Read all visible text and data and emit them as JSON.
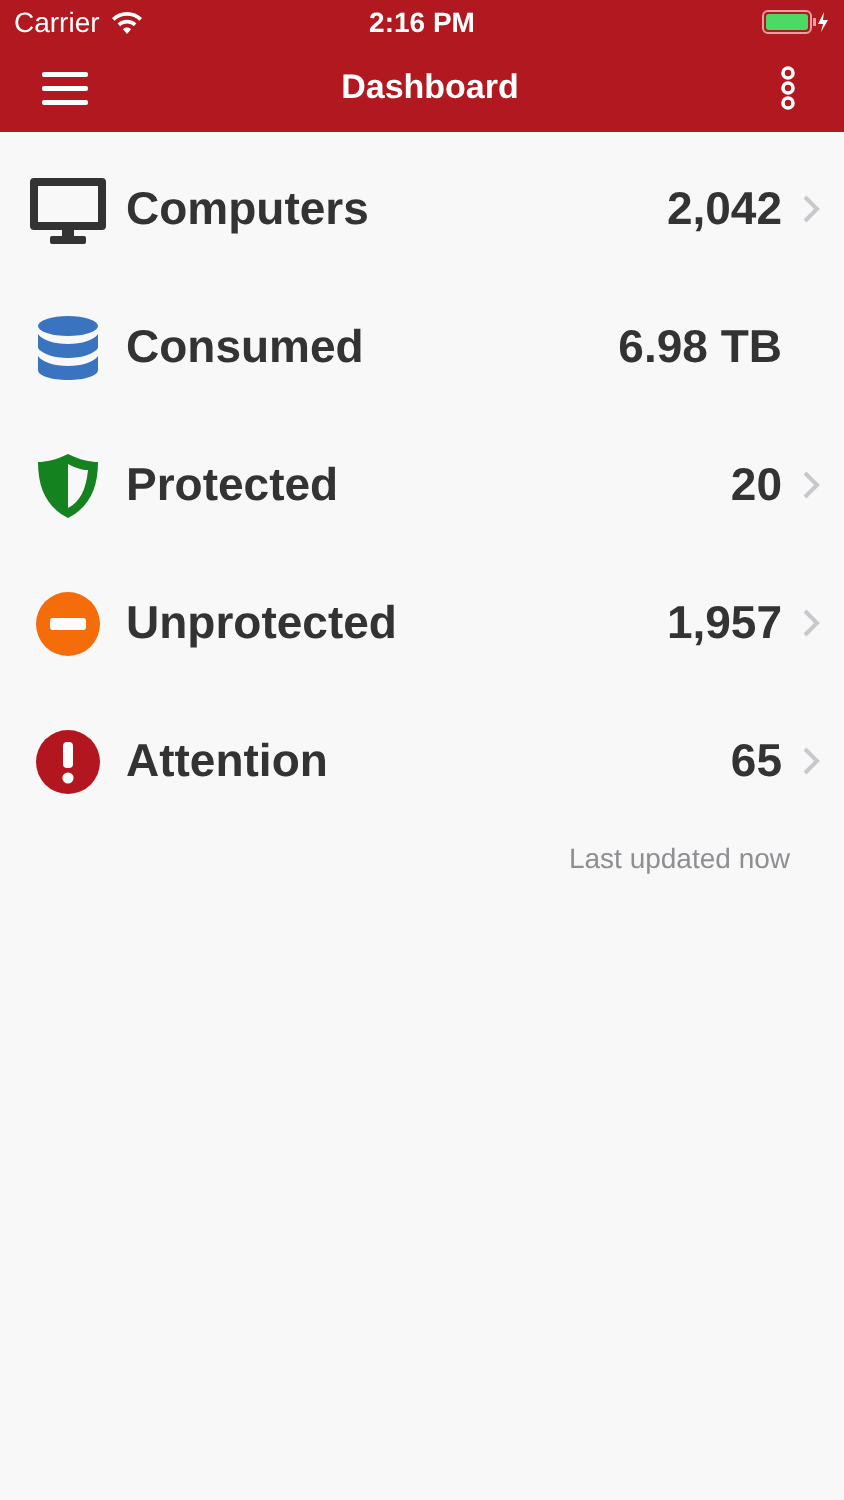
{
  "status_bar": {
    "carrier": "Carrier",
    "time": "2:16 PM"
  },
  "nav_bar": {
    "title": "Dashboard"
  },
  "stats": [
    {
      "kind": "computer",
      "label": "Computers",
      "value": "2,042",
      "navigable": true
    },
    {
      "kind": "storage",
      "label": "Consumed",
      "value": "6.98 TB",
      "navigable": false
    },
    {
      "kind": "shield",
      "label": "Protected",
      "value": "20",
      "navigable": true
    },
    {
      "kind": "blocked",
      "label": "Unprotected",
      "value": "1,957",
      "navigable": true
    },
    {
      "kind": "alert",
      "label": "Attention",
      "value": "65",
      "navigable": true
    }
  ],
  "footer": "Last updated now"
}
